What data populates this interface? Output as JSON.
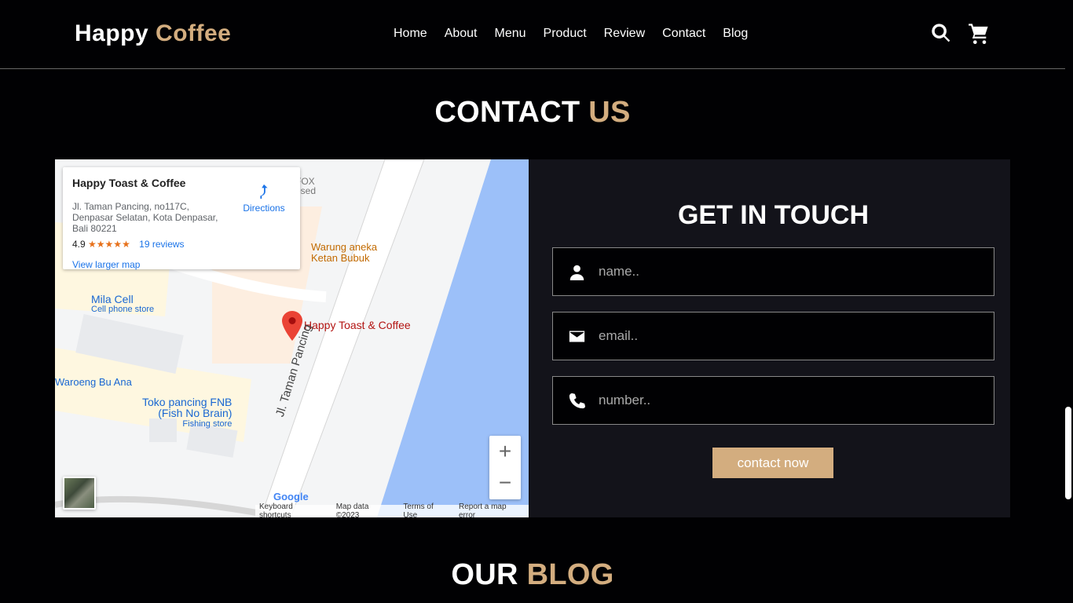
{
  "header": {
    "logo_part1": "Happy",
    "logo_part2": "Coffee",
    "nav": [
      "Home",
      "About",
      "Menu",
      "Product",
      "Review",
      "Contact",
      "Blog"
    ],
    "icons": [
      "search-icon",
      "cart-icon"
    ]
  },
  "contact": {
    "title_part1": "CONTACT",
    "title_part2": "US",
    "form": {
      "title": "GET IN TOUCH",
      "name_placeholder": "name..",
      "email_placeholder": "email..",
      "number_placeholder": "number..",
      "submit_label": "contact now"
    },
    "map": {
      "place_name": "Happy Toast & Coffee",
      "address": "Jl. Taman Pancing, no117C, Denpasar Selatan, Kota Denpasar, Bali 80221",
      "rating": "4.9",
      "stars": "★★★★★",
      "reviews": "19 reviews",
      "view_larger": "View larger map",
      "directions": "Directions",
      "labels": {
        "warung_line1": "Warung aneka",
        "warung_line2": "Ketan Bubuk",
        "pin_label": "Happy Toast & Coffee",
        "mila_cell": "Mila Cell",
        "mila_sub": "Cell phone store",
        "waroeng": "Waroeng Bu Ana",
        "toko_line1": "Toko pancing FNB",
        "toko_line2": "(Fish No Brain)",
        "toko_sub": "Fishing store",
        "street": "Jl. Taman Pancing",
        "fox": "FOX",
        "closed": "osed"
      },
      "zoom_in": "+",
      "zoom_out": "−",
      "google": "Google",
      "attribution": [
        "Keyboard shortcuts",
        "Map data ©2023",
        "Terms of Use",
        "Report a map error"
      ]
    }
  },
  "blog": {
    "title_part1": "OUR",
    "title_part2": "BLOG"
  },
  "colors": {
    "accent": "#d3ad7f",
    "background": "#010103",
    "panel": "#13131a"
  }
}
